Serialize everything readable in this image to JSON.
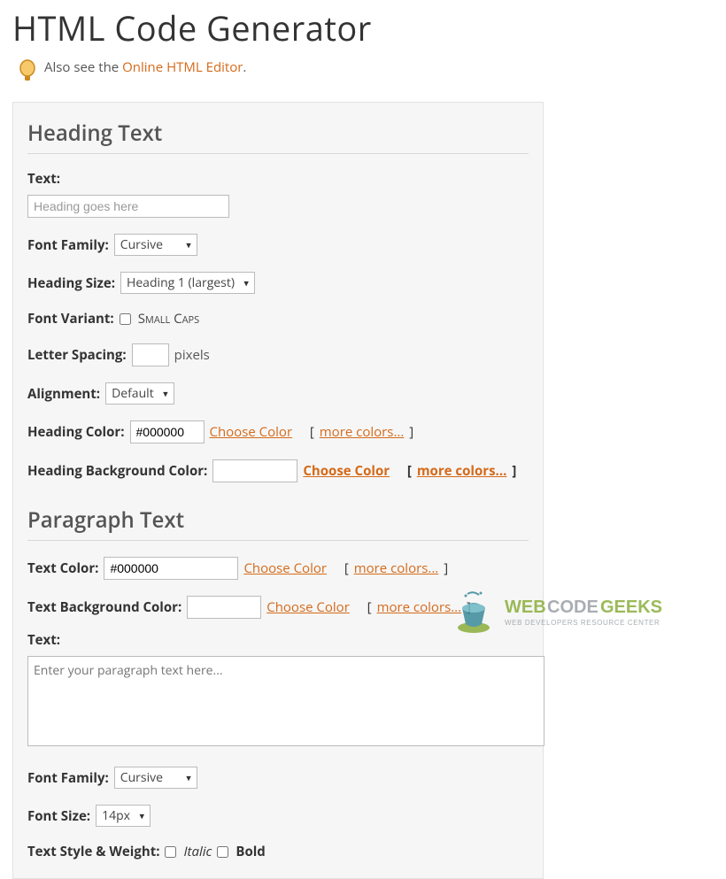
{
  "page": {
    "title": "HTML Code Generator",
    "tip_prefix": "Also see the ",
    "tip_link": "Online HTML Editor",
    "tip_suffix": "."
  },
  "heading": {
    "section_title": "Heading Text",
    "text_label": "Text:",
    "text_placeholder": "Heading goes here",
    "font_family_label": "Font Family:",
    "font_family_value": "Cursive",
    "heading_size_label": "Heading Size:",
    "heading_size_value": "Heading 1 (largest)",
    "font_variant_label": "Font Variant:",
    "font_variant_option": "Small Caps",
    "letter_spacing_label": "Letter Spacing:",
    "letter_spacing_unit": "pixels",
    "alignment_label": "Alignment:",
    "alignment_value": "Default",
    "heading_color_label": "Heading Color:",
    "heading_color_value": "#000000",
    "choose_color": "Choose Color",
    "more_colors": "more colors...",
    "heading_bg_label": "Heading Background Color:"
  },
  "paragraph": {
    "section_title": "Paragraph Text",
    "text_color_label": "Text Color:",
    "text_color_value": "#000000",
    "choose_color": "Choose Color",
    "more_colors": "more colors...",
    "text_bg_label": "Text Background Color:",
    "text_label": "Text:",
    "text_placeholder": "Enter your paragraph text here...",
    "font_family_label": "Font Family:",
    "font_family_value": "Cursive",
    "font_size_label": "Font Size:",
    "font_size_value": "14px",
    "style_weight_label": "Text Style & Weight:",
    "italic_option": "Italic",
    "bold_option": "Bold"
  },
  "watermark": {
    "line1a": "WEB ",
    "line1b": "CODE ",
    "line1c": "GEEKS",
    "line2": "WEB DEVELOPERS RESOURCE CENTER"
  }
}
